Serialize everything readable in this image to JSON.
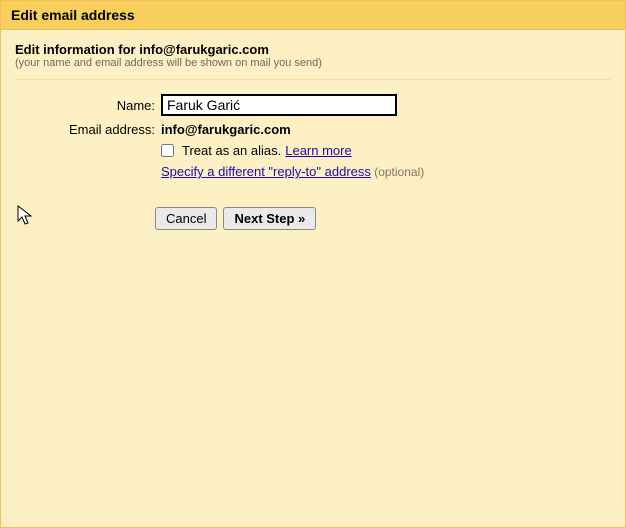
{
  "window": {
    "title": "Edit email address"
  },
  "subheader": {
    "line1": "Edit information for info@farukgaric.com",
    "line2": "(your name and email address will be shown on mail you send)"
  },
  "form": {
    "name_label": "Name:",
    "name_value": "Faruk Garić",
    "email_label": "Email address:",
    "email_value": "info@farukgaric.com",
    "alias_checkbox_label": "Treat as an alias.",
    "learn_more": "Learn more",
    "reply_to_link": "Specify a different \"reply-to\" address",
    "optional_text": " (optional)"
  },
  "buttons": {
    "cancel": "Cancel",
    "next": "Next Step »"
  }
}
